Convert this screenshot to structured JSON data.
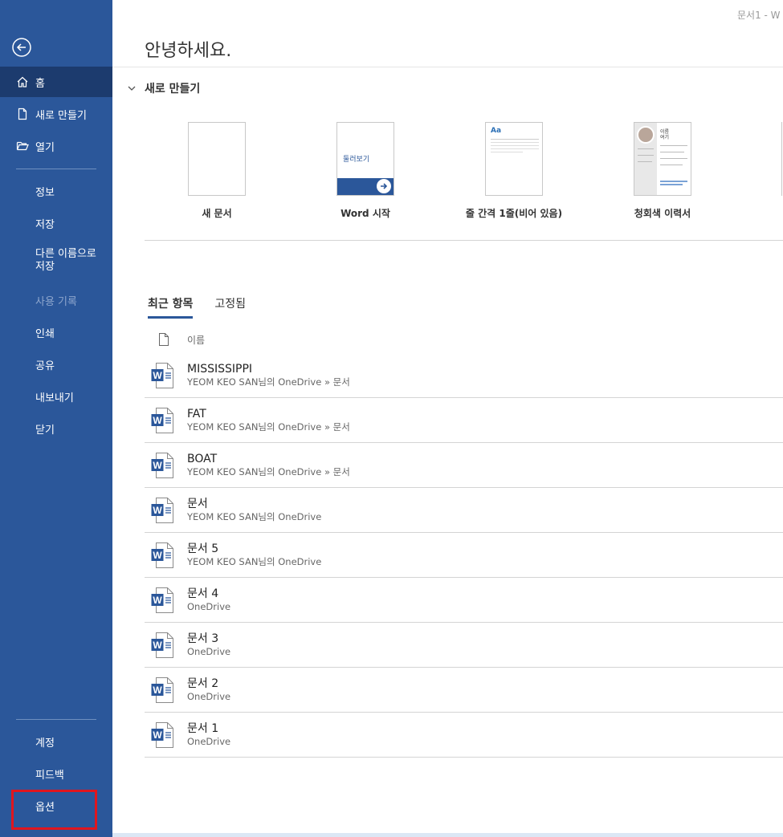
{
  "window": {
    "title": "문서1 - W"
  },
  "sidebar": {
    "back_icon": "back-arrow-icon",
    "home": {
      "label": "홈",
      "icon": "home-icon"
    },
    "new": {
      "label": "새로 만들기",
      "icon": "new-document-icon"
    },
    "open": {
      "label": "열기",
      "icon": "folder-open-icon"
    },
    "items": [
      "정보",
      "저장",
      "다른 이름으로\n저장",
      "사용 기록",
      "인쇄",
      "공유",
      "내보내기",
      "닫기"
    ],
    "bottom_items": [
      "계정",
      "피드백",
      "옵션"
    ],
    "color": "#2b579a",
    "active_color": "#1c3b6e",
    "highlight_color": "#e0161e"
  },
  "main": {
    "greeting": "안녕하세요.",
    "new_section_title": "새로 만들기",
    "templates": [
      {
        "label": "새 문서"
      },
      {
        "label": "Word 시작",
        "thumb_text": "둘러보기"
      },
      {
        "label": "줄 간격 1줄(비어 있음)",
        "thumb_text": "Aa"
      },
      {
        "label": "청회색 이력서",
        "thumb_text": "이름\n여기"
      }
    ],
    "tabs": [
      "최근 항목",
      "고정됨"
    ],
    "column_name": "이름",
    "files": [
      {
        "name": "MISSISSIPPI",
        "path": "YEOM KEO SAN님의 OneDrive » 문서"
      },
      {
        "name": "FAT",
        "path": "YEOM KEO SAN님의 OneDrive » 문서"
      },
      {
        "name": "BOAT",
        "path": "YEOM KEO SAN님의 OneDrive » 문서"
      },
      {
        "name": "문서",
        "path": "YEOM KEO SAN님의 OneDrive"
      },
      {
        "name": "문서 5",
        "path": "YEOM KEO SAN님의 OneDrive"
      },
      {
        "name": "문서 4",
        "path": "OneDrive"
      },
      {
        "name": "문서 3",
        "path": "OneDrive"
      },
      {
        "name": "문서 2",
        "path": "OneDrive"
      },
      {
        "name": "문서 1",
        "path": "OneDrive"
      }
    ]
  }
}
